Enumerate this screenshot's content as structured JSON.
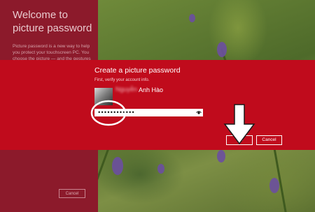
{
  "side_panel": {
    "title": "Welcome to picture password",
    "description": "Picture password is a new way to help you protect your touchscreen PC. You choose the picture — and the gestures",
    "cancel_label": "Cancel"
  },
  "dialog": {
    "title": "Create a picture password",
    "subtitle": "First, verify your account info.",
    "username_blurred": "Nguyễn",
    "username": "Anh Hào",
    "password_value": "••••••••••••",
    "ok_label": "OK",
    "cancel_label": "Cancel"
  },
  "colors": {
    "band": "#c00b1c",
    "side_panel": "#8c1a2b"
  },
  "icons": {
    "password_reveal": "eye-icon",
    "annotation_arrow": "arrow-down-icon",
    "annotation_circle": "ellipse-annotation"
  }
}
